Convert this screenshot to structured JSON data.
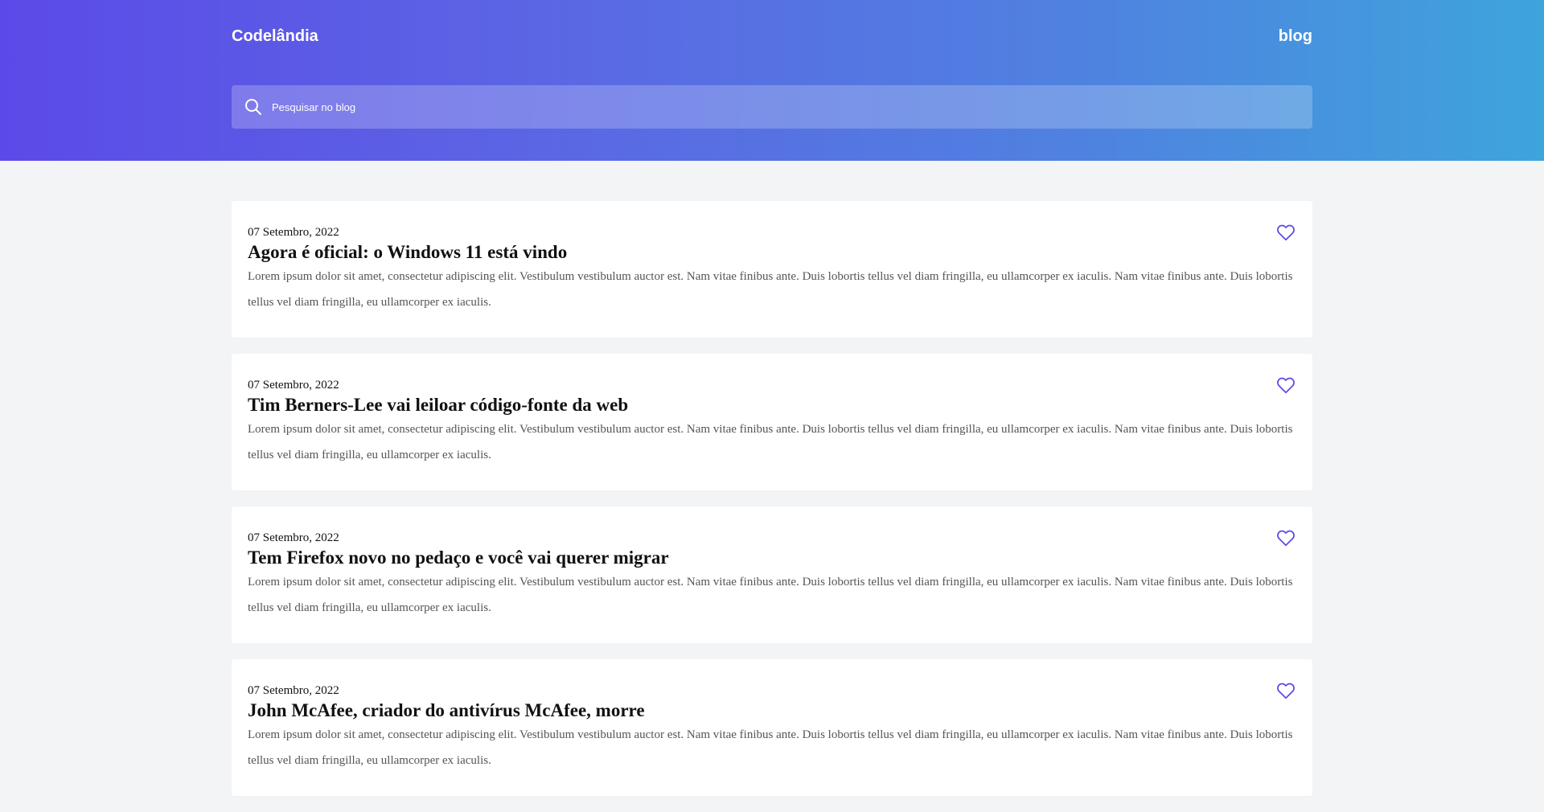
{
  "header": {
    "logo": "Codelândia",
    "nav_link": "blog",
    "search_placeholder": "Pesquisar no blog"
  },
  "colors": {
    "accent": "#5b4ae8",
    "gradient_end": "#3ea4dc",
    "heart": "#5b4ae8"
  },
  "posts": [
    {
      "date": "07 Setembro, 2022",
      "title": "Agora é oficial: o Windows 11 está vindo",
      "excerpt": "Lorem ipsum dolor sit amet, consectetur adipiscing elit. Vestibulum vestibulum auctor est. Nam vitae finibus ante. Duis lobortis tellus vel diam fringilla, eu ullamcorper ex iaculis. Nam vitae finibus ante. Duis lobortis tellus vel diam fringilla, eu ullamcorper ex iaculis.",
      "icon": "heart-outline-icon"
    },
    {
      "date": "07 Setembro, 2022",
      "title": "Tim Berners-Lee vai leiloar código-fonte da web",
      "excerpt": "Lorem ipsum dolor sit amet, consectetur adipiscing elit. Vestibulum vestibulum auctor est. Nam vitae finibus ante. Duis lobortis tellus vel diam fringilla, eu ullamcorper ex iaculis. Nam vitae finibus ante. Duis lobortis tellus vel diam fringilla, eu ullamcorper ex iaculis.",
      "icon": "heart-outline-icon"
    },
    {
      "date": "07 Setembro, 2022",
      "title": "Tem Firefox novo no pedaço e você vai querer migrar",
      "excerpt": "Lorem ipsum dolor sit amet, consectetur adipiscing elit. Vestibulum vestibulum auctor est. Nam vitae finibus ante. Duis lobortis tellus vel diam fringilla, eu ullamcorper ex iaculis. Nam vitae finibus ante. Duis lobortis tellus vel diam fringilla, eu ullamcorper ex iaculis.",
      "icon": "heart-outline-icon"
    },
    {
      "date": "07 Setembro, 2022",
      "title": "John McAfee, criador do antivírus McAfee, morre",
      "excerpt": "Lorem ipsum dolor sit amet, consectetur adipiscing elit. Vestibulum vestibulum auctor est. Nam vitae finibus ante. Duis lobortis tellus vel diam fringilla, eu ullamcorper ex iaculis. Nam vitae finibus ante. Duis lobortis tellus vel diam fringilla, eu ullamcorper ex iaculis.",
      "icon": "heart-outline-icon"
    }
  ]
}
